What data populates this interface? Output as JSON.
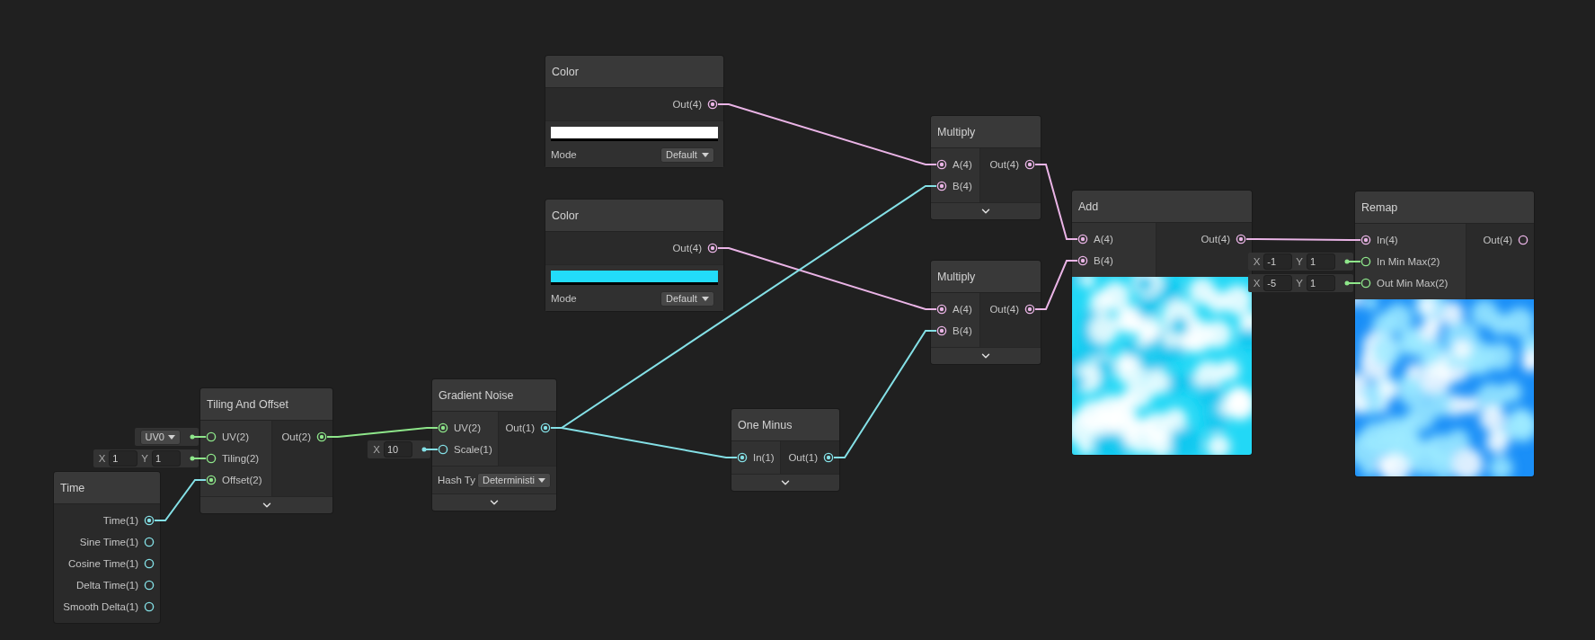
{
  "nodes": [
    {
      "kind": "color",
      "title": "Color",
      "outputs": [
        {
          "label": "Out(4)",
          "color": "#eab4e6",
          "connected": true
        }
      ],
      "color": "#ffffff",
      "mode": {
        "label": "Mode",
        "value": "Default"
      }
    },
    {
      "kind": "color",
      "title": "Color",
      "outputs": [
        {
          "label": "Out(4)",
          "color": "#eab4e6",
          "connected": true
        }
      ],
      "color": "#22dcfa",
      "mode": {
        "label": "Mode",
        "value": "Default"
      }
    },
    {
      "kind": "math",
      "title": "Multiply",
      "inputs": [
        {
          "label": "A(4)",
          "color": "#eab4e6",
          "connected": true
        },
        {
          "label": "B(4)",
          "color": "#eab4e6",
          "connected": true
        }
      ],
      "outputs": [
        {
          "label": "Out(4)",
          "color": "#eab4e6",
          "connected": true
        }
      ]
    },
    {
      "kind": "math",
      "title": "Multiply",
      "inputs": [
        {
          "label": "A(4)",
          "color": "#eab4e6",
          "connected": true
        },
        {
          "label": "B(4)",
          "color": "#eab4e6",
          "connected": true
        }
      ],
      "outputs": [
        {
          "label": "Out(4)",
          "color": "#eab4e6",
          "connected": true
        }
      ]
    },
    {
      "kind": "preview",
      "title": "Add",
      "inputs": [
        {
          "label": "A(4)",
          "color": "#eab4e6",
          "connected": true
        },
        {
          "label": "B(4)",
          "color": "#eab4e6",
          "connected": true
        }
      ],
      "outputs": [
        {
          "label": "Out(4)",
          "color": "#eab4e6",
          "connected": true
        }
      ]
    },
    {
      "kind": "preview",
      "title": "Remap",
      "inputs": [
        {
          "label": "In(4)",
          "color": "#eab4e6",
          "connected": true
        },
        {
          "label": "In Min Max(2)",
          "color": "#8ee68a",
          "connected": false,
          "default": {
            "kind": "vector",
            "fields": [
              {
                "label": "X",
                "value": "-1"
              },
              {
                "label": "Y",
                "value": "1"
              }
            ]
          }
        },
        {
          "label": "Out Min Max(2)",
          "color": "#8ee68a",
          "connected": false,
          "default": {
            "kind": "vector",
            "fields": [
              {
                "label": "X",
                "value": "-5"
              },
              {
                "label": "Y",
                "value": "1"
              }
            ]
          }
        }
      ],
      "outputs": [
        {
          "label": "Out(4)",
          "color": "#eab4e6",
          "connected": false
        }
      ]
    },
    {
      "kind": "math",
      "title": "Tiling And Offset",
      "inputs": [
        {
          "label": "UV(2)",
          "color": "#8ee68a",
          "connected": false,
          "default": {
            "kind": "dropdown",
            "value": "UV0"
          }
        },
        {
          "label": "Tiling(2)",
          "color": "#8ee68a",
          "connected": false,
          "default": {
            "kind": "vector",
            "fields": [
              {
                "label": "X",
                "value": "1"
              },
              {
                "label": "Y",
                "value": "1"
              }
            ]
          }
        },
        {
          "label": "Offset(2)",
          "color": "#8ee68a",
          "connected": true
        }
      ],
      "outputs": [
        {
          "label": "Out(2)",
          "color": "#8ee68a",
          "connected": true
        }
      ]
    },
    {
      "kind": "time",
      "title": "Time",
      "outputs": [
        {
          "label": "Time(1)",
          "color": "#84e0e6",
          "connected": true
        },
        {
          "label": "Sine Time(1)",
          "color": "#84e0e6",
          "connected": false
        },
        {
          "label": "Cosine Time(1)",
          "color": "#84e0e6",
          "connected": false
        },
        {
          "label": "Delta Time(1)",
          "color": "#84e0e6",
          "connected": false
        },
        {
          "label": "Smooth Delta(1)",
          "color": "#84e0e6",
          "connected": false
        }
      ]
    },
    {
      "kind": "noise",
      "title": "Gradient Noise",
      "inputs": [
        {
          "label": "UV(2)",
          "color": "#8ee68a",
          "connected": true
        },
        {
          "label": "Scale(1)",
          "color": "#84e0e6",
          "connected": false,
          "default": {
            "kind": "vector",
            "fields": [
              {
                "label": "X",
                "value": "10"
              }
            ]
          }
        }
      ],
      "outputs": [
        {
          "label": "Out(1)",
          "color": "#84e0e6",
          "connected": true
        }
      ],
      "hash": {
        "label": "Hash Ty",
        "value": "Deterministi"
      }
    },
    {
      "kind": "math",
      "title": "One Minus",
      "inputs": [
        {
          "label": "In(1)",
          "color": "#84e0e6",
          "connected": true
        }
      ],
      "outputs": [
        {
          "label": "Out(1)",
          "color": "#84e0e6",
          "connected": true
        }
      ]
    }
  ]
}
